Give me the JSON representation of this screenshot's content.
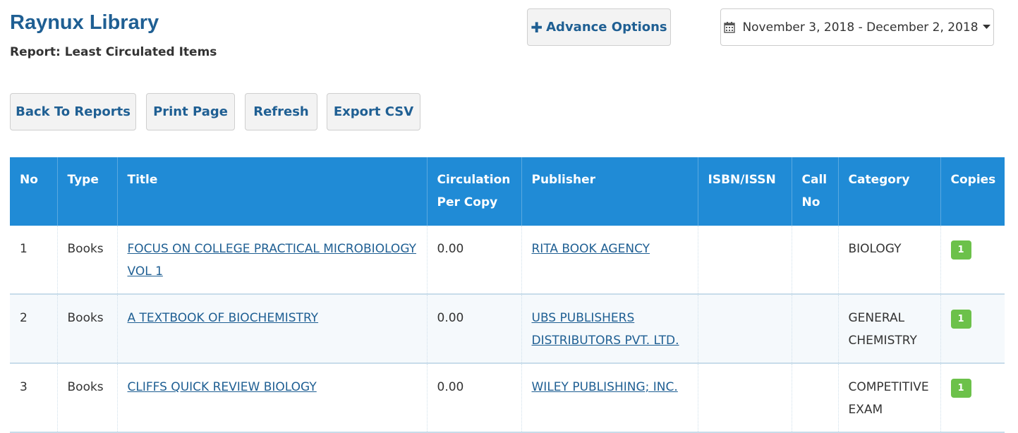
{
  "header": {
    "app_title": "Raynux Library",
    "report_label": "Report: Least Circulated Items"
  },
  "toolbar": {
    "advance_options_label": "Advance Options",
    "date_range_label": "November 3, 2018 - December 2, 2018",
    "back_label": "Back To Reports",
    "print_label": "Print Page",
    "refresh_label": "Refresh",
    "export_label": "Export CSV"
  },
  "table": {
    "columns": [
      "No",
      "Type",
      "Title",
      "Circulation Per Copy",
      "Publisher",
      "ISBN/ISSN",
      "Call No",
      "Category",
      "Copies"
    ],
    "rows": [
      {
        "no": "1",
        "type": "Books",
        "title": "FOCUS ON COLLEGE PRACTICAL MICROBIOLOGY VOL 1",
        "circulation": "0.00",
        "publisher": "RITA BOOK AGENCY",
        "isbn": "",
        "call_no": "",
        "category": "BIOLOGY",
        "copies": "1"
      },
      {
        "no": "2",
        "type": "Books",
        "title": "A TEXTBOOK OF BIOCHEMISTRY",
        "circulation": "0.00",
        "publisher": "UBS PUBLISHERS DISTRIBUTORS PVT. LTD.",
        "isbn": "",
        "call_no": "",
        "category": "GENERAL CHEMISTRY",
        "copies": "1"
      },
      {
        "no": "3",
        "type": "Books",
        "title": "CLIFFS QUICK REVIEW BIOLOGY",
        "circulation": "0.00",
        "publisher": "WILEY PUBLISHING; INC.",
        "isbn": "",
        "call_no": "",
        "category": "COMPETITIVE EXAM",
        "copies": "1"
      }
    ]
  },
  "colors": {
    "brand": "#1f5f93",
    "table_header": "#208bd6",
    "badge": "#6cc14a"
  },
  "icons": {
    "advance": "plus-icon",
    "date": "calendar-icon",
    "caret": "caret-down-icon"
  }
}
